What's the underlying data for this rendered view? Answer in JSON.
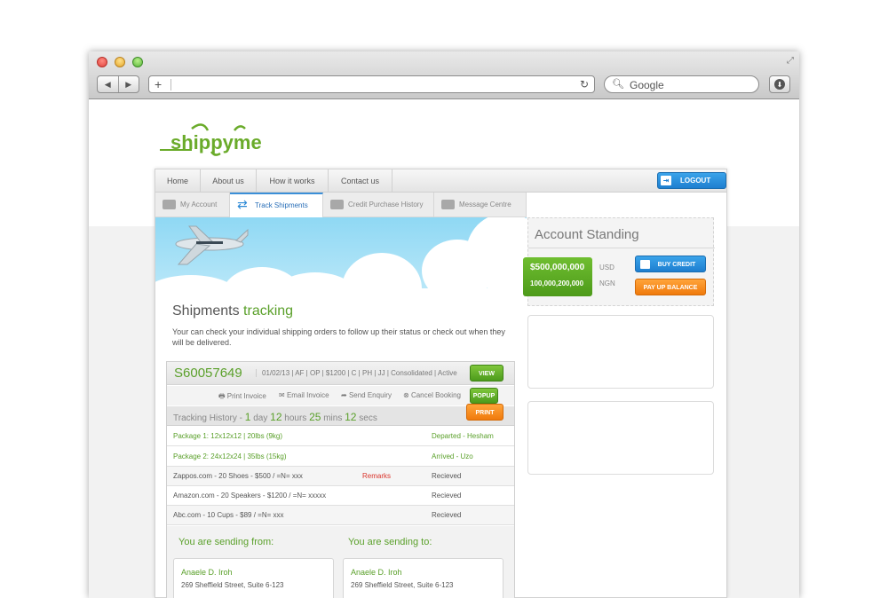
{
  "browser": {
    "search_placeholder": "Google",
    "url": ""
  },
  "nav": {
    "items": [
      "Home",
      "About us",
      "How it works",
      "Contact us"
    ],
    "logout": "LOGOUT"
  },
  "subnav": {
    "items": [
      "My Account",
      "Track Shipments",
      "Credit Purchase History",
      "Message Centre"
    ],
    "active": "Track Shipments"
  },
  "page": {
    "title_prefix": "Shipments",
    "title_highlight": "tracking",
    "description": "Your can check your individual shipping orders to follow up their status or check out when they will be delivered."
  },
  "shipment": {
    "id": "S60057649",
    "meta": "01/02/13 | AF | OP | $1200 | C | PH | JJ | Consolidated | Active",
    "view_label": "VIEW",
    "popup_label": "POPUP",
    "print_label": "PRINT",
    "actions": [
      "Print Invoice",
      "Email Invoice",
      "Send Enquiry",
      "Cancel Booking"
    ],
    "history_label": "Tracking History -",
    "timer": {
      "days": "1",
      "day_unit": "day",
      "hours": "12",
      "hour_unit": "hours",
      "mins": "25",
      "min_unit": "mins",
      "secs": "12",
      "sec_unit": "secs"
    },
    "packages": [
      {
        "desc": "Package 1: 12x12x12 | 20lbs (9kg)",
        "status": "Departed - Hesham"
      },
      {
        "desc": "Package 2: 24x12x24 | 35lbs (15kg)",
        "status": "Arrived - Uzo"
      }
    ],
    "items": [
      {
        "desc": "Zappos.com - 20 Shoes - $500 / =N= xxx",
        "remark": "Remarks",
        "status": "Recieved"
      },
      {
        "desc": "Amazon.com - 20 Speakers - $1200 / =N= xxxxx",
        "remark": "",
        "status": "Recieved"
      },
      {
        "desc": "Abc.com - 10 Cups - $89 / =N= xxx",
        "remark": "",
        "status": "Recieved"
      }
    ],
    "from_label": "You are sending from:",
    "to_label": "You are sending to:",
    "from": {
      "name": "Anaele D. Iroh",
      "street": "269 Sheffield Street, Suite 6-123"
    },
    "to": {
      "name": "Anaele D. Iroh",
      "street": "269 Sheffield Street, Suite 6-123"
    }
  },
  "account": {
    "title": "Account Standing",
    "usd_amount": "$500,000,000",
    "usd_label": "USD",
    "ngn_amount": "100,000,200,000",
    "ngn_label": "NGN",
    "buy_credit": "BUY CREDIT",
    "pay_up": "PAY UP BALANCE"
  },
  "colors": {
    "accent_green": "#5aa02a",
    "accent_blue": "#1e7fd0",
    "accent_orange": "#f07a0c"
  }
}
